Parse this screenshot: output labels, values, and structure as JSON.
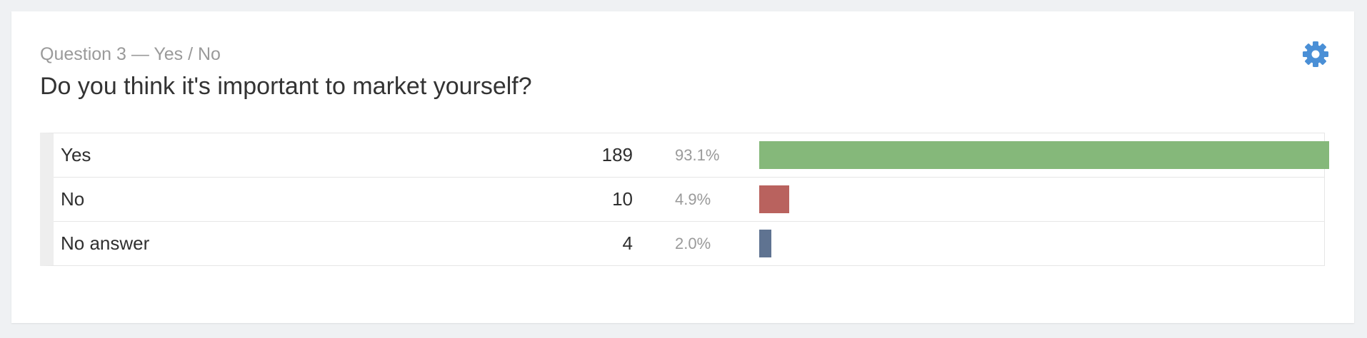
{
  "question": {
    "subtitle": "Question 3 — Yes / No",
    "title": "Do you think it's important to market yourself?",
    "settings_icon": "gear-icon",
    "settings_color": "#4a8fd6"
  },
  "answers": [
    {
      "label": "Yes",
      "count": "189",
      "percent": "93.1%",
      "fraction": 0.931,
      "color": "#85b87a"
    },
    {
      "label": "No",
      "count": "10",
      "percent": "4.9%",
      "fraction": 0.049,
      "color": "#b9625e"
    },
    {
      "label": "No answer",
      "count": "4",
      "percent": "2.0%",
      "fraction": 0.02,
      "color": "#5f7391"
    }
  ]
}
